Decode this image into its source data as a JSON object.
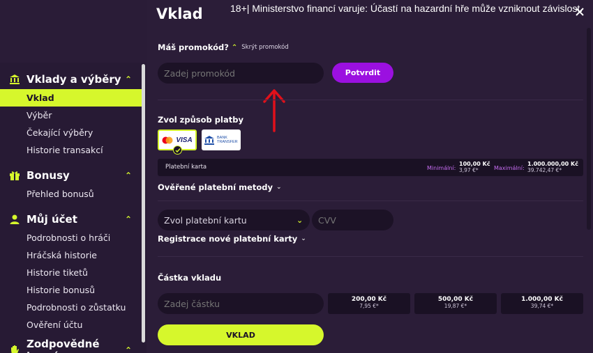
{
  "sidebar": {
    "sections": [
      {
        "title": "Vklady a výběry",
        "icon": "bank-icon",
        "items": [
          "Vklad",
          "Výběr",
          "Čekající výběry",
          "Historie transakcí"
        ],
        "active": 0
      },
      {
        "title": "Bonusy",
        "icon": "gift-icon",
        "items": [
          "Přehled bonusů"
        ]
      },
      {
        "title": "Můj účet",
        "icon": "user-icon",
        "items": [
          "Podrobnosti o hráči",
          "Hráčská historie",
          "Historie tiketů",
          "Historie bonusů",
          "Podrobnosti o zůstatku",
          "Ověření účtu"
        ]
      },
      {
        "title": "Zodpovědné hraní",
        "icon": "hand-icon",
        "items": []
      }
    ]
  },
  "header": {
    "title": "Vklad",
    "warning": "18+| Ministerstvo financí varuje: Účastí na hazardní hře může vzniknout závislost."
  },
  "promo": {
    "label": "Máš promokód?",
    "hide_link": "Skrýt promokód",
    "placeholder": "Zadej promokód",
    "confirm": "Potvrdit"
  },
  "payment": {
    "label": "Zvol způsob platby",
    "methods": [
      {
        "name": "VISA",
        "icon": "mastercard-visa-icon",
        "selected": true
      },
      {
        "name": "BANK TRANSFER",
        "icon": "bank-transfer-icon",
        "selected": false
      }
    ],
    "method_name": "Platební karta",
    "min_label": "Minimální:",
    "min_value": "100,00 Kč",
    "min_eur": "3,97 €*",
    "max_label": "Maximální:",
    "max_value": "1.000.000,00 Kč",
    "max_eur": "39.742,47 €*",
    "verified_label": "Ověřené platební metody",
    "card_select": "Zvol platební kartu",
    "cvv": "CVV",
    "register_label": "Registrace nové platební karty"
  },
  "amount": {
    "label": "Částka vkladu",
    "placeholder": "Zadej částku",
    "quick": [
      {
        "value": "200,00 Kč",
        "eur": "7,95 €*"
      },
      {
        "value": "500,00 Kč",
        "eur": "19,87 €*"
      },
      {
        "value": "1.000,00 Kč",
        "eur": "39,74 €*"
      }
    ]
  },
  "submit": "VKLAD",
  "colors": {
    "accent": "#d6f72c",
    "purple": "#9b10e0",
    "bg": "#2b1d38",
    "annotation_arrow": "#e0101a"
  }
}
